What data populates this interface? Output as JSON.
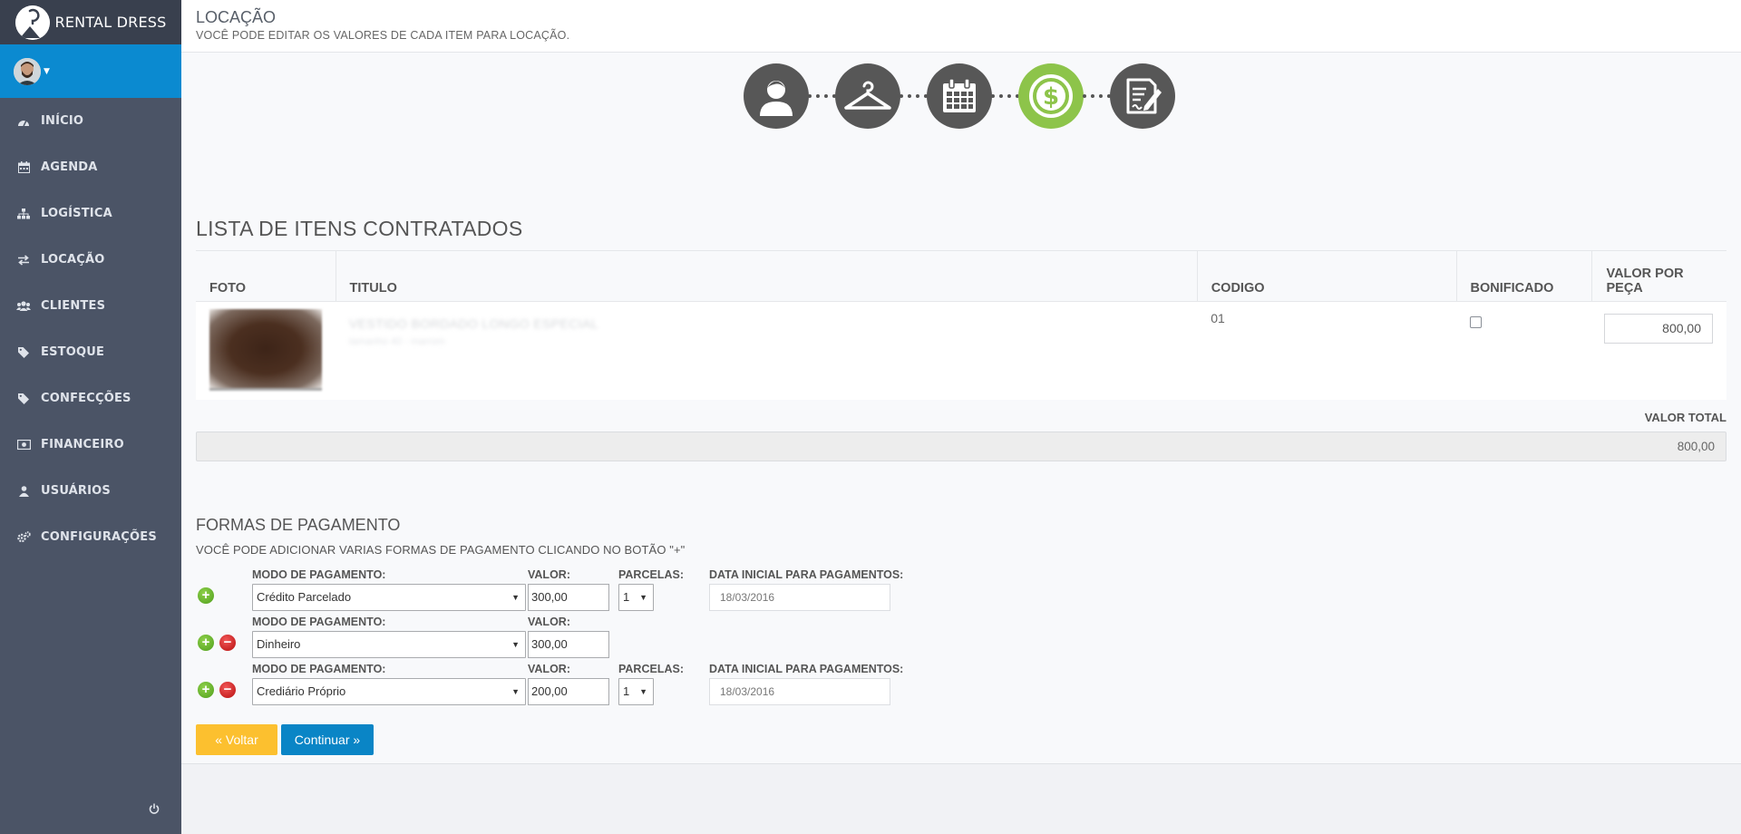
{
  "brand": {
    "name": "RENTAL DRESS"
  },
  "sidebar": {
    "items": [
      {
        "label": "INÍCIO",
        "icon": "dashboard-icon"
      },
      {
        "label": "AGENDA",
        "icon": "calendar-icon"
      },
      {
        "label": "LOGÍSTICA",
        "icon": "sitemap-icon"
      },
      {
        "label": "LOCAÇÃO",
        "icon": "exchange-icon"
      },
      {
        "label": "CLIENTES",
        "icon": "users-icon"
      },
      {
        "label": "ESTOQUE",
        "icon": "tag-icon"
      },
      {
        "label": "CONFECÇÕES",
        "icon": "tag-icon"
      },
      {
        "label": "FINANCEIRO",
        "icon": "money-icon"
      },
      {
        "label": "USUÁRIOS",
        "icon": "user-icon"
      },
      {
        "label": "CONFIGURAÇÕES",
        "icon": "cogs-icon"
      }
    ]
  },
  "header": {
    "title": "LOCAÇÃO",
    "subtitle": "VOCÊ PODE EDITAR OS VALORES DE CADA ITEM PARA LOCAÇÃO."
  },
  "steps": [
    {
      "icon": "client-icon",
      "active": false
    },
    {
      "icon": "hanger-icon",
      "active": false
    },
    {
      "icon": "calendar-icon",
      "active": false
    },
    {
      "icon": "dollar-icon",
      "active": true
    },
    {
      "icon": "contract-icon",
      "active": false
    }
  ],
  "items": {
    "title": "LISTA DE ITENS CONTRATADOS",
    "columns": [
      "FOTO",
      "TITULO",
      "CODIGO",
      "BONIFICADO",
      "VALOR POR PEÇA"
    ],
    "rows": [
      {
        "titulo": "VESTIDO BORDADO LONGO ESPECIAL",
        "titulo_sub": "tamanho 40 - marrom",
        "codigo": "01",
        "bonificado": false,
        "valor": "800,00"
      }
    ],
    "total_label": "VALOR TOTAL",
    "total_value": "800,00"
  },
  "payment": {
    "title": "FORMAS DE PAGAMENTO",
    "hint": "VOCÊ PODE ADICIONAR VARIAS FORMAS DE PAGAMENTO CLICANDO NO BOTÃO \"+\"",
    "labels": {
      "mode": "MODO DE PAGAMENTO:",
      "value": "VALOR:",
      "installments": "PARCELAS:",
      "start_date": "DATA INICIAL PARA PAGAMENTOS:"
    },
    "rows": [
      {
        "mode": "Crédito Parcelado",
        "value": "300,00",
        "installments": "1",
        "date": "18/03/2016"
      },
      {
        "mode": "Dinheiro",
        "value": "300,00"
      },
      {
        "mode": "Crediário Próprio",
        "value": "200,00",
        "installments": "1",
        "date": "18/03/2016"
      }
    ]
  },
  "buttons": {
    "back": "« Voltar",
    "next": "Continuar »"
  }
}
